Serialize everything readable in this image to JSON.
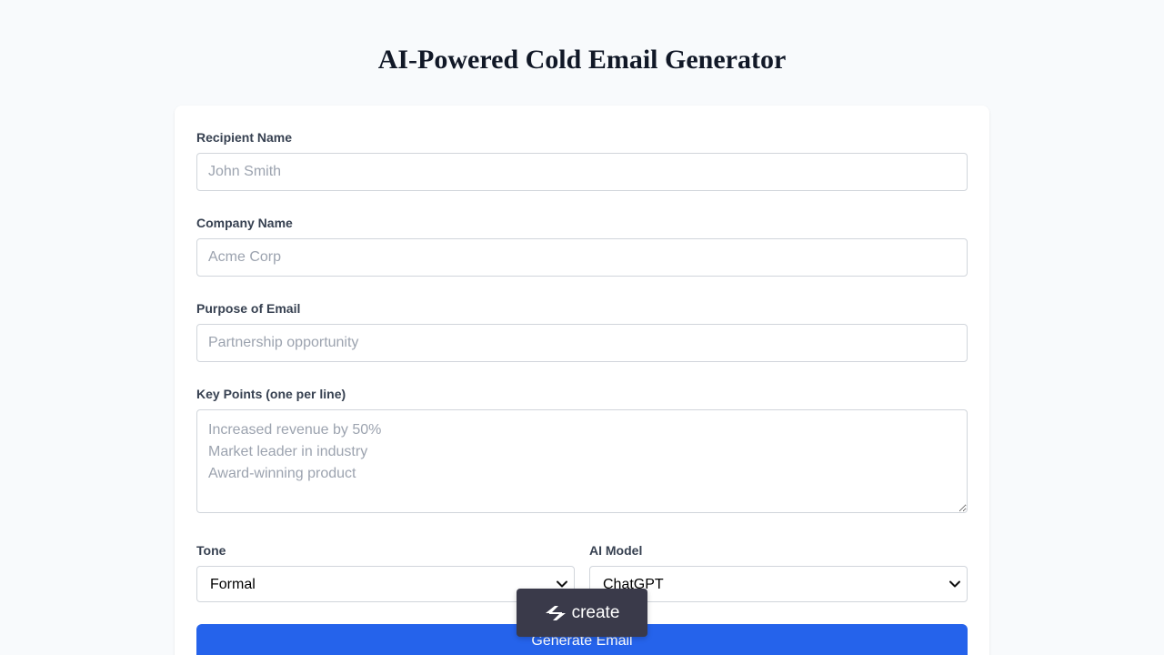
{
  "page": {
    "title": "AI-Powered Cold Email Generator"
  },
  "form": {
    "recipient": {
      "label": "Recipient Name",
      "placeholder": "John Smith",
      "value": ""
    },
    "company": {
      "label": "Company Name",
      "placeholder": "Acme Corp",
      "value": ""
    },
    "purpose": {
      "label": "Purpose of Email",
      "placeholder": "Partnership opportunity",
      "value": ""
    },
    "key_points": {
      "label": "Key Points (one per line)",
      "placeholder": "Increased revenue by 50%\nMarket leader in industry\nAward-winning product",
      "value": ""
    },
    "tone": {
      "label": "Tone",
      "selected": "Formal"
    },
    "model": {
      "label": "AI Model",
      "selected": "ChatGPT"
    },
    "submit_label": "Generate Email"
  },
  "badge": {
    "label": "create",
    "icon": "create-logo-icon"
  },
  "colors": {
    "background": "#f8fafc",
    "primary_button": "#2563eb",
    "badge": "#3a3a4a"
  }
}
